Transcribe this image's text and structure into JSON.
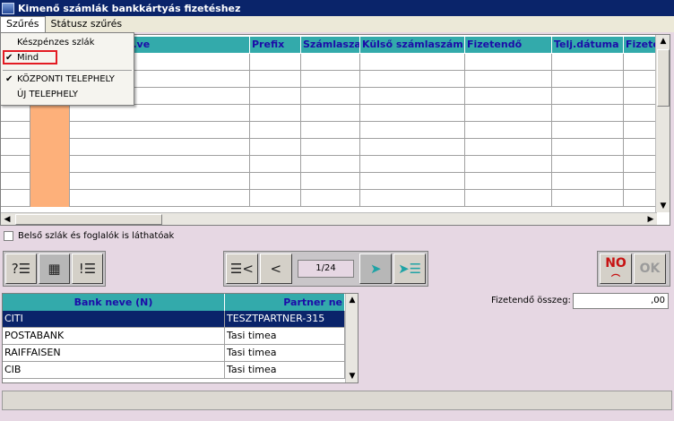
{
  "window": {
    "title": "Kimenő számlák bankkártyás fizetéshez"
  },
  "menubar": {
    "items": [
      "Szűrés",
      "Státusz szűrés"
    ]
  },
  "dropdown": {
    "items": [
      {
        "label": "Készpénzes szlák",
        "checked": false
      },
      {
        "label": "Mind",
        "checked": true
      },
      {
        "label": "KÖZPONTI TELEPHELY",
        "checked": true
      },
      {
        "label": "ÚJ TELEPHELY",
        "checked": false
      }
    ]
  },
  "main_grid": {
    "columns": [
      "",
      "",
      "...ve",
      "Prefix",
      "Számlasza",
      "Külső számlaszám",
      "Fizetendő",
      "Telj.dátuma",
      "Fizete"
    ]
  },
  "checkbox": {
    "label": "Belső szlák és foglalók is láthatóak",
    "checked": false
  },
  "pager": {
    "label": "1/24"
  },
  "actions": {
    "no_label": "NO",
    "ok_label": "OK"
  },
  "bank_grid": {
    "columns": [
      "Bank neve (N)",
      "Partner ne"
    ],
    "rows": [
      [
        "CITI",
        "TESZTPARTNER-315"
      ],
      [
        "POSTABANK",
        "Tasi timea"
      ],
      [
        "RAIFFAISEN",
        "Tasi timea"
      ],
      [
        "CIB",
        "Tasi timea"
      ]
    ],
    "selected_row": 0
  },
  "amount": {
    "label": "Fizetendő összeg:",
    "value": ",00"
  },
  "colors": {
    "header": "#33aaab",
    "header_text": "#1c0ca8",
    "titlebar": "#0a246a",
    "highlight": "#e31b23",
    "orange": "#fdb07a"
  }
}
